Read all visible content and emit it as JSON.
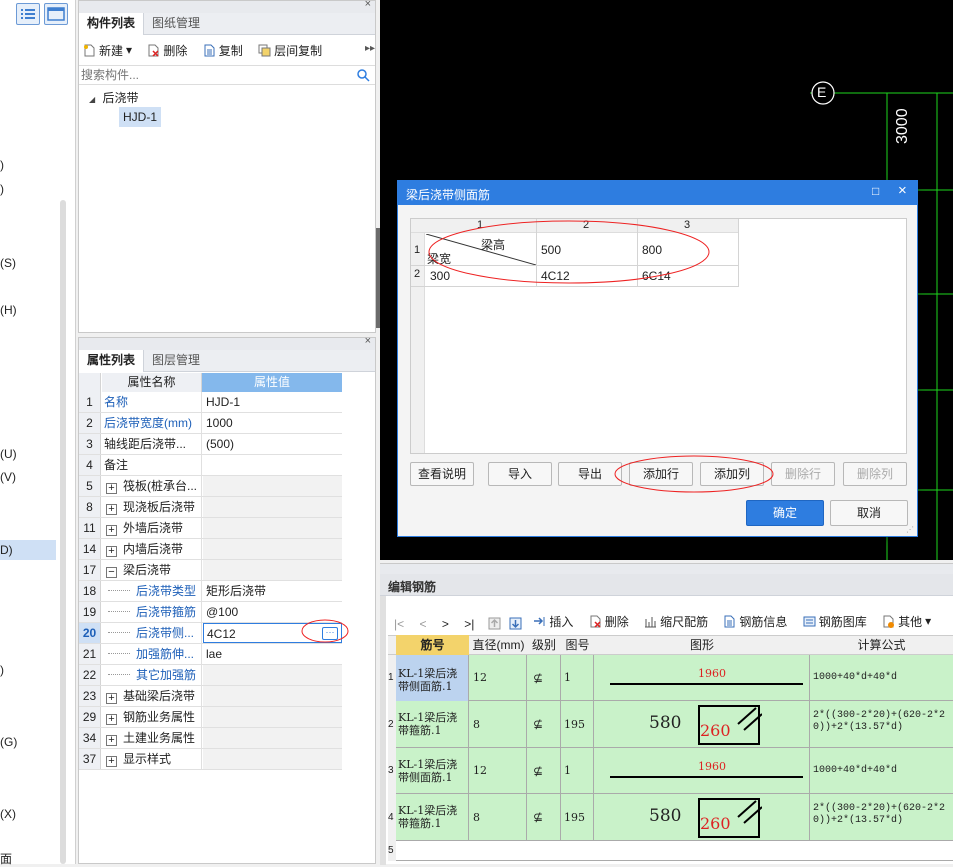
{
  "left_sidebar": {
    "fragments": [
      ")",
      ")",
      "(S)",
      "(H)",
      "(U)",
      "(V)",
      "D)",
      ")",
      "(G)",
      "(X)",
      "面"
    ]
  },
  "component_panel": {
    "tabs": [
      "构件列表",
      "图纸管理"
    ],
    "toolbar": {
      "new": "新建",
      "delete": "删除",
      "copy": "复制",
      "floor_copy": "层间复制"
    },
    "search_placeholder": "搜索构件...",
    "tree": {
      "group": "后浇带",
      "item": "HJD-1"
    }
  },
  "property_panel": {
    "tabs": [
      "属性列表",
      "图层管理"
    ],
    "headers": {
      "name": "属性名称",
      "value": "属性值"
    },
    "rows": [
      {
        "num": "1",
        "name": "名称",
        "value": "HJD-1"
      },
      {
        "num": "2",
        "name": "后浇带宽度(mm)",
        "value": "1000"
      },
      {
        "num": "3",
        "name": "轴线距后浇带...",
        "value": "(500)"
      },
      {
        "num": "4",
        "name": "备注",
        "value": ""
      },
      {
        "num": "5",
        "name": "筏板(桩承台...",
        "value": ""
      },
      {
        "num": "8",
        "name": "现浇板后浇带",
        "value": ""
      },
      {
        "num": "11",
        "name": "外墙后浇带",
        "value": ""
      },
      {
        "num": "14",
        "name": "内墙后浇带",
        "value": ""
      },
      {
        "num": "17",
        "name": "梁后浇带",
        "value": ""
      },
      {
        "num": "18",
        "name": "后浇带类型",
        "value": "矩形后浇带"
      },
      {
        "num": "19",
        "name": "后浇带箍筋",
        "value": "@100"
      },
      {
        "num": "20",
        "name": "后浇带侧...",
        "value": "4C12"
      },
      {
        "num": "21",
        "name": "加强筋伸...",
        "value": "lae"
      },
      {
        "num": "22",
        "name": "其它加强筋",
        "value": ""
      },
      {
        "num": "23",
        "name": "基础梁后浇带",
        "value": ""
      },
      {
        "num": "29",
        "name": "钢筋业务属性",
        "value": ""
      },
      {
        "num": "34",
        "name": "土建业务属性",
        "value": ""
      },
      {
        "num": "37",
        "name": "显示样式",
        "value": ""
      }
    ]
  },
  "cad": {
    "axis_label": "E",
    "dimension": "3000"
  },
  "dialog": {
    "title": "梁后浇带侧面筋",
    "col_headers": [
      "1",
      "2",
      "3"
    ],
    "row_headers": [
      "1",
      "2"
    ],
    "corner_top": "梁高",
    "corner_bottom": "梁宽",
    "heights": [
      "500",
      "800"
    ],
    "width": "300",
    "values": [
      "4C12",
      "6C14"
    ],
    "buttons": {
      "help": "查看说明",
      "import": "导入",
      "export": "导出",
      "add_row": "添加行",
      "add_col": "添加列",
      "del_row": "删除行",
      "del_col": "删除列"
    },
    "ok": "确定",
    "cancel": "取消"
  },
  "rebar_editor": {
    "title": "编辑钢筋",
    "toolbar": {
      "insert": "插入",
      "delete": "删除",
      "scale": "缩尺配筋",
      "info": "钢筋信息",
      "library": "钢筋图库",
      "other": "其他"
    },
    "headers": {
      "bar": "筋号",
      "dia": "直径(mm)",
      "grade": "级别",
      "shape_no": "图号",
      "shape": "图形",
      "formula": "计算公式"
    },
    "rows": [
      {
        "num": "1",
        "bar": "KL-1梁后浇带侧面筋.1",
        "dia": "12",
        "grade": "⊈",
        "shape_no": "1",
        "len": "1960",
        "formula": "1000+40*d+40*d"
      },
      {
        "num": "2",
        "bar": "KL-1梁后浇带箍筋.1",
        "dia": "8",
        "grade": "⊈",
        "shape_no": "195",
        "w": "580",
        "h": "260",
        "formula": "2*((300-2*20)+(620-2*20))+2*(13.57*d)"
      },
      {
        "num": "3",
        "bar": "KL-1梁后浇带侧面筋.1",
        "dia": "12",
        "grade": "⊈",
        "shape_no": "1",
        "len": "1960",
        "formula": "1000+40*d+40*d"
      },
      {
        "num": "4",
        "bar": "KL-1梁后浇带箍筋.1",
        "dia": "8",
        "grade": "⊈",
        "shape_no": "195",
        "w": "580",
        "h": "260",
        "formula": "2*((300-2*20)+(620-2*20))+2*(13.57*d)"
      },
      {
        "num": "5"
      }
    ]
  }
}
